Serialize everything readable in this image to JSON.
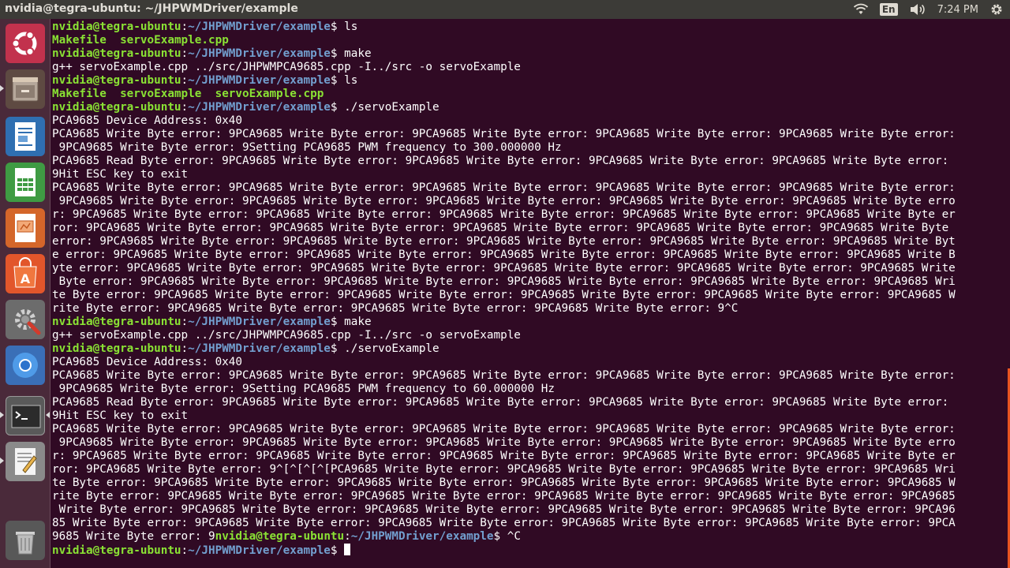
{
  "window": {
    "title": "nvidia@tegra-ubuntu: ~/JHPWMDriver/example"
  },
  "indicators": {
    "language": "En",
    "clock": "7:24 PM"
  },
  "icons": {
    "network": "wifi-icon",
    "sound": "volume-icon",
    "session": "gear-icon"
  },
  "launcher": [
    {
      "name": "dash-home",
      "icon": "ubuntu-logo-icon",
      "running": false
    },
    {
      "name": "files",
      "icon": "file-cabinet-icon",
      "running": true
    },
    {
      "name": "writer",
      "icon": "text-document-icon",
      "running": false
    },
    {
      "name": "calc",
      "icon": "spreadsheet-icon",
      "running": false
    },
    {
      "name": "impress",
      "icon": "presentation-icon",
      "running": false
    },
    {
      "name": "software-center",
      "icon": "shopping-bag-icon",
      "running": false
    },
    {
      "name": "system-settings",
      "icon": "settings-tools-icon",
      "running": false
    },
    {
      "name": "chromium",
      "icon": "chromium-icon",
      "running": false
    },
    {
      "name": "terminal",
      "icon": "terminal-icon",
      "running": true,
      "focused": true
    },
    {
      "name": "text-editor",
      "icon": "text-editor-icon",
      "running": true
    },
    {
      "name": "trash",
      "icon": "trash-icon",
      "running": false
    }
  ],
  "colors": {
    "prompt_user": "#8ae234",
    "prompt_path": "#729fcf",
    "background": "#300a24",
    "scroll": "#e95420"
  },
  "terminal": {
    "prompt_user": "nvidia@tegra-ubuntu",
    "prompt_path": "~/JHPWMDriver/example",
    "lines": [
      {
        "type": "cmd",
        "cmd": "ls"
      },
      {
        "type": "ls",
        "items": [
          {
            "t": "Makefile  ",
            "x": false
          },
          {
            "t": "servoExample.cpp",
            "x": false
          }
        ]
      },
      {
        "type": "cmd",
        "cmd": "make"
      },
      {
        "type": "out",
        "text": "g++ servoExample.cpp ../src/JHPWMPCA9685.cpp -I../src -o servoExample"
      },
      {
        "type": "cmd",
        "cmd": "ls"
      },
      {
        "type": "ls",
        "items": [
          {
            "t": "Makefile  ",
            "x": false
          },
          {
            "t": "servoExample",
            "x": true
          },
          {
            "t": "  servoExample.cpp",
            "x": false
          }
        ]
      },
      {
        "type": "cmd",
        "cmd": "./servoExample"
      },
      {
        "type": "out",
        "text": "PCA9685 Device Address: 0x40"
      },
      {
        "type": "out",
        "text": "PCA9685 Write Byte error: 9PCA9685 Write Byte error: 9PCA9685 Write Byte error: 9PCA9685 Write Byte error: 9PCA9685 Write Byte error:"
      },
      {
        "type": "out",
        "text": " 9PCA9685 Write Byte error: 9Setting PCA9685 PWM frequency to 300.000000 Hz"
      },
      {
        "type": "out",
        "text": "PCA9685 Read Byte error: 9PCA9685 Write Byte error: 9PCA9685 Write Byte error: 9PCA9685 Write Byte error: 9PCA9685 Write Byte error:"
      },
      {
        "type": "out",
        "text": "9Hit ESC key to exit"
      },
      {
        "type": "out",
        "text": "PCA9685 Write Byte error: 9PCA9685 Write Byte error: 9PCA9685 Write Byte error: 9PCA9685 Write Byte error: 9PCA9685 Write Byte error:"
      },
      {
        "type": "out",
        "text": " 9PCA9685 Write Byte error: 9PCA9685 Write Byte error: 9PCA9685 Write Byte error: 9PCA9685 Write Byte error: 9PCA9685 Write Byte erro"
      },
      {
        "type": "out",
        "text": "r: 9PCA9685 Write Byte error: 9PCA9685 Write Byte error: 9PCA9685 Write Byte error: 9PCA9685 Write Byte error: 9PCA9685 Write Byte er"
      },
      {
        "type": "out",
        "text": "ror: 9PCA9685 Write Byte error: 9PCA9685 Write Byte error: 9PCA9685 Write Byte error: 9PCA9685 Write Byte error: 9PCA9685 Write Byte"
      },
      {
        "type": "out",
        "text": "error: 9PCA9685 Write Byte error: 9PCA9685 Write Byte error: 9PCA9685 Write Byte error: 9PCA9685 Write Byte error: 9PCA9685 Write Byt"
      },
      {
        "type": "out",
        "text": "e error: 9PCA9685 Write Byte error: 9PCA9685 Write Byte error: 9PCA9685 Write Byte error: 9PCA9685 Write Byte error: 9PCA9685 Write B"
      },
      {
        "type": "out",
        "text": "yte error: 9PCA9685 Write Byte error: 9PCA9685 Write Byte error: 9PCA9685 Write Byte error: 9PCA9685 Write Byte error: 9PCA9685 Write"
      },
      {
        "type": "out",
        "text": " Byte error: 9PCA9685 Write Byte error: 9PCA9685 Write Byte error: 9PCA9685 Write Byte error: 9PCA9685 Write Byte error: 9PCA9685 Wri"
      },
      {
        "type": "out",
        "text": "te Byte error: 9PCA9685 Write Byte error: 9PCA9685 Write Byte error: 9PCA9685 Write Byte error: 9PCA9685 Write Byte error: 9PCA9685 W"
      },
      {
        "type": "out",
        "text": "rite Byte error: 9PCA9685 Write Byte error: 9PCA9685 Write Byte error: 9PCA9685 Write Byte error: 9^C"
      },
      {
        "type": "cmd",
        "cmd": "make"
      },
      {
        "type": "out",
        "text": "g++ servoExample.cpp ../src/JHPWMPCA9685.cpp -I../src -o servoExample"
      },
      {
        "type": "cmd",
        "cmd": "./servoExample"
      },
      {
        "type": "out",
        "text": "PCA9685 Device Address: 0x40"
      },
      {
        "type": "out",
        "text": "PCA9685 Write Byte error: 9PCA9685 Write Byte error: 9PCA9685 Write Byte error: 9PCA9685 Write Byte error: 9PCA9685 Write Byte error:"
      },
      {
        "type": "out",
        "text": " 9PCA9685 Write Byte error: 9Setting PCA9685 PWM frequency to 60.000000 Hz"
      },
      {
        "type": "out",
        "text": "PCA9685 Read Byte error: 9PCA9685 Write Byte error: 9PCA9685 Write Byte error: 9PCA9685 Write Byte error: 9PCA9685 Write Byte error:"
      },
      {
        "type": "out",
        "text": "9Hit ESC key to exit"
      },
      {
        "type": "out",
        "text": "PCA9685 Write Byte error: 9PCA9685 Write Byte error: 9PCA9685 Write Byte error: 9PCA9685 Write Byte error: 9PCA9685 Write Byte error:"
      },
      {
        "type": "out",
        "text": " 9PCA9685 Write Byte error: 9PCA9685 Write Byte error: 9PCA9685 Write Byte error: 9PCA9685 Write Byte error: 9PCA9685 Write Byte erro"
      },
      {
        "type": "out",
        "text": "r: 9PCA9685 Write Byte error: 9PCA9685 Write Byte error: 9PCA9685 Write Byte error: 9PCA9685 Write Byte error: 9PCA9685 Write Byte er"
      },
      {
        "type": "out",
        "text": "ror: 9PCA9685 Write Byte error: 9^[^[^[^[PCA9685 Write Byte error: 9PCA9685 Write Byte error: 9PCA9685 Write Byte error: 9PCA9685 Wri"
      },
      {
        "type": "out",
        "text": "te Byte error: 9PCA9685 Write Byte error: 9PCA9685 Write Byte error: 9PCA9685 Write Byte error: 9PCA9685 Write Byte error: 9PCA9685 W"
      },
      {
        "type": "out",
        "text": "rite Byte error: 9PCA9685 Write Byte error: 9PCA9685 Write Byte error: 9PCA9685 Write Byte error: 9PCA9685 Write Byte error: 9PCA9685"
      },
      {
        "type": "out",
        "text": " Write Byte error: 9PCA9685 Write Byte error: 9PCA9685 Write Byte error: 9PCA9685 Write Byte error: 9PCA9685 Write Byte error: 9PCA96"
      },
      {
        "type": "out",
        "text": "85 Write Byte error: 9PCA9685 Write Byte error: 9PCA9685 Write Byte error: 9PCA9685 Write Byte error: 9PCA9685 Write Byte error: 9PCA"
      },
      {
        "type": "mixed",
        "pre": "9685 Write Byte error: 9",
        "cmd": "^C"
      },
      {
        "type": "cmd",
        "cmd": "",
        "cursor": true
      }
    ]
  }
}
